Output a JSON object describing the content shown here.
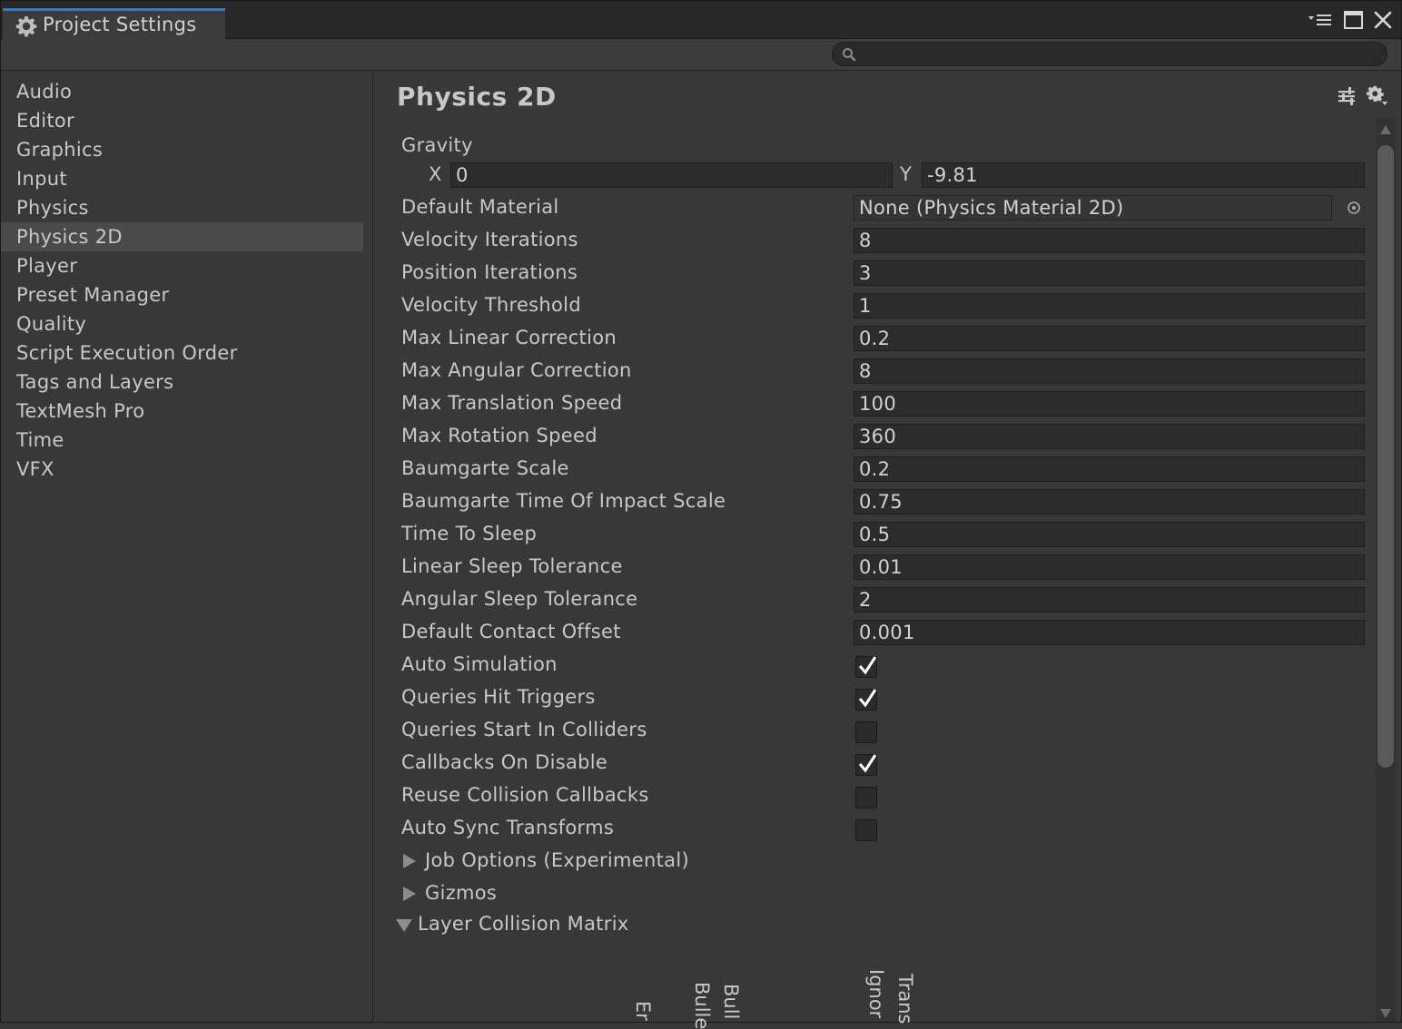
{
  "window": {
    "tab_title": "Project Settings",
    "tab_icon": "gear-icon",
    "controls": [
      "menu-icon",
      "maximize-icon",
      "close-icon"
    ]
  },
  "search": {
    "value": "",
    "icon": "search-icon"
  },
  "sidebar": {
    "selected": "Physics 2D",
    "items": [
      "Audio",
      "Editor",
      "Graphics",
      "Input",
      "Physics",
      "Physics 2D",
      "Player",
      "Preset Manager",
      "Quality",
      "Script Execution Order",
      "Tags and Layers",
      "TextMesh Pro",
      "Time",
      "VFX"
    ]
  },
  "main": {
    "title": "Physics 2D",
    "header_icons": [
      "presets-icon",
      "settings-gear-icon"
    ],
    "gravity": {
      "label": "Gravity",
      "x_label": "X",
      "x_value": "0",
      "y_label": "Y",
      "y_value": "-9.81"
    },
    "default_material": {
      "label": "Default Material",
      "value": "None (Physics Material 2D)"
    },
    "fields": [
      {
        "label": "Velocity Iterations",
        "value": "8"
      },
      {
        "label": "Position Iterations",
        "value": "3"
      },
      {
        "label": "Velocity Threshold",
        "value": "1"
      },
      {
        "label": "Max Linear Correction",
        "value": "0.2"
      },
      {
        "label": "Max Angular Correction",
        "value": "8"
      },
      {
        "label": "Max Translation Speed",
        "value": "100"
      },
      {
        "label": "Max Rotation Speed",
        "value": "360"
      },
      {
        "label": "Baumgarte Scale",
        "value": "0.2"
      },
      {
        "label": "Baumgarte Time Of Impact Scale",
        "value": "0.75"
      },
      {
        "label": "Time To Sleep",
        "value": "0.5"
      },
      {
        "label": "Linear Sleep Tolerance",
        "value": "0.01"
      },
      {
        "label": "Angular Sleep Tolerance",
        "value": "2"
      },
      {
        "label": "Default Contact Offset",
        "value": "0.001"
      }
    ],
    "toggles": [
      {
        "label": "Auto Simulation",
        "checked": true
      },
      {
        "label": "Queries Hit Triggers",
        "checked": true
      },
      {
        "label": "Queries Start In Colliders",
        "checked": false
      },
      {
        "label": "Callbacks On Disable",
        "checked": true
      },
      {
        "label": "Reuse Collision Callbacks",
        "checked": false
      },
      {
        "label": "Auto Sync Transforms",
        "checked": false
      }
    ],
    "foldouts": [
      {
        "label": "Job Options (Experimental)",
        "expanded": false
      },
      {
        "label": "Gizmos",
        "expanded": false
      },
      {
        "label": "Layer Collision Matrix",
        "expanded": true
      }
    ],
    "matrix_columns": [
      "Er",
      "Bulle",
      "Bull",
      "Ignor",
      "Trans"
    ]
  }
}
